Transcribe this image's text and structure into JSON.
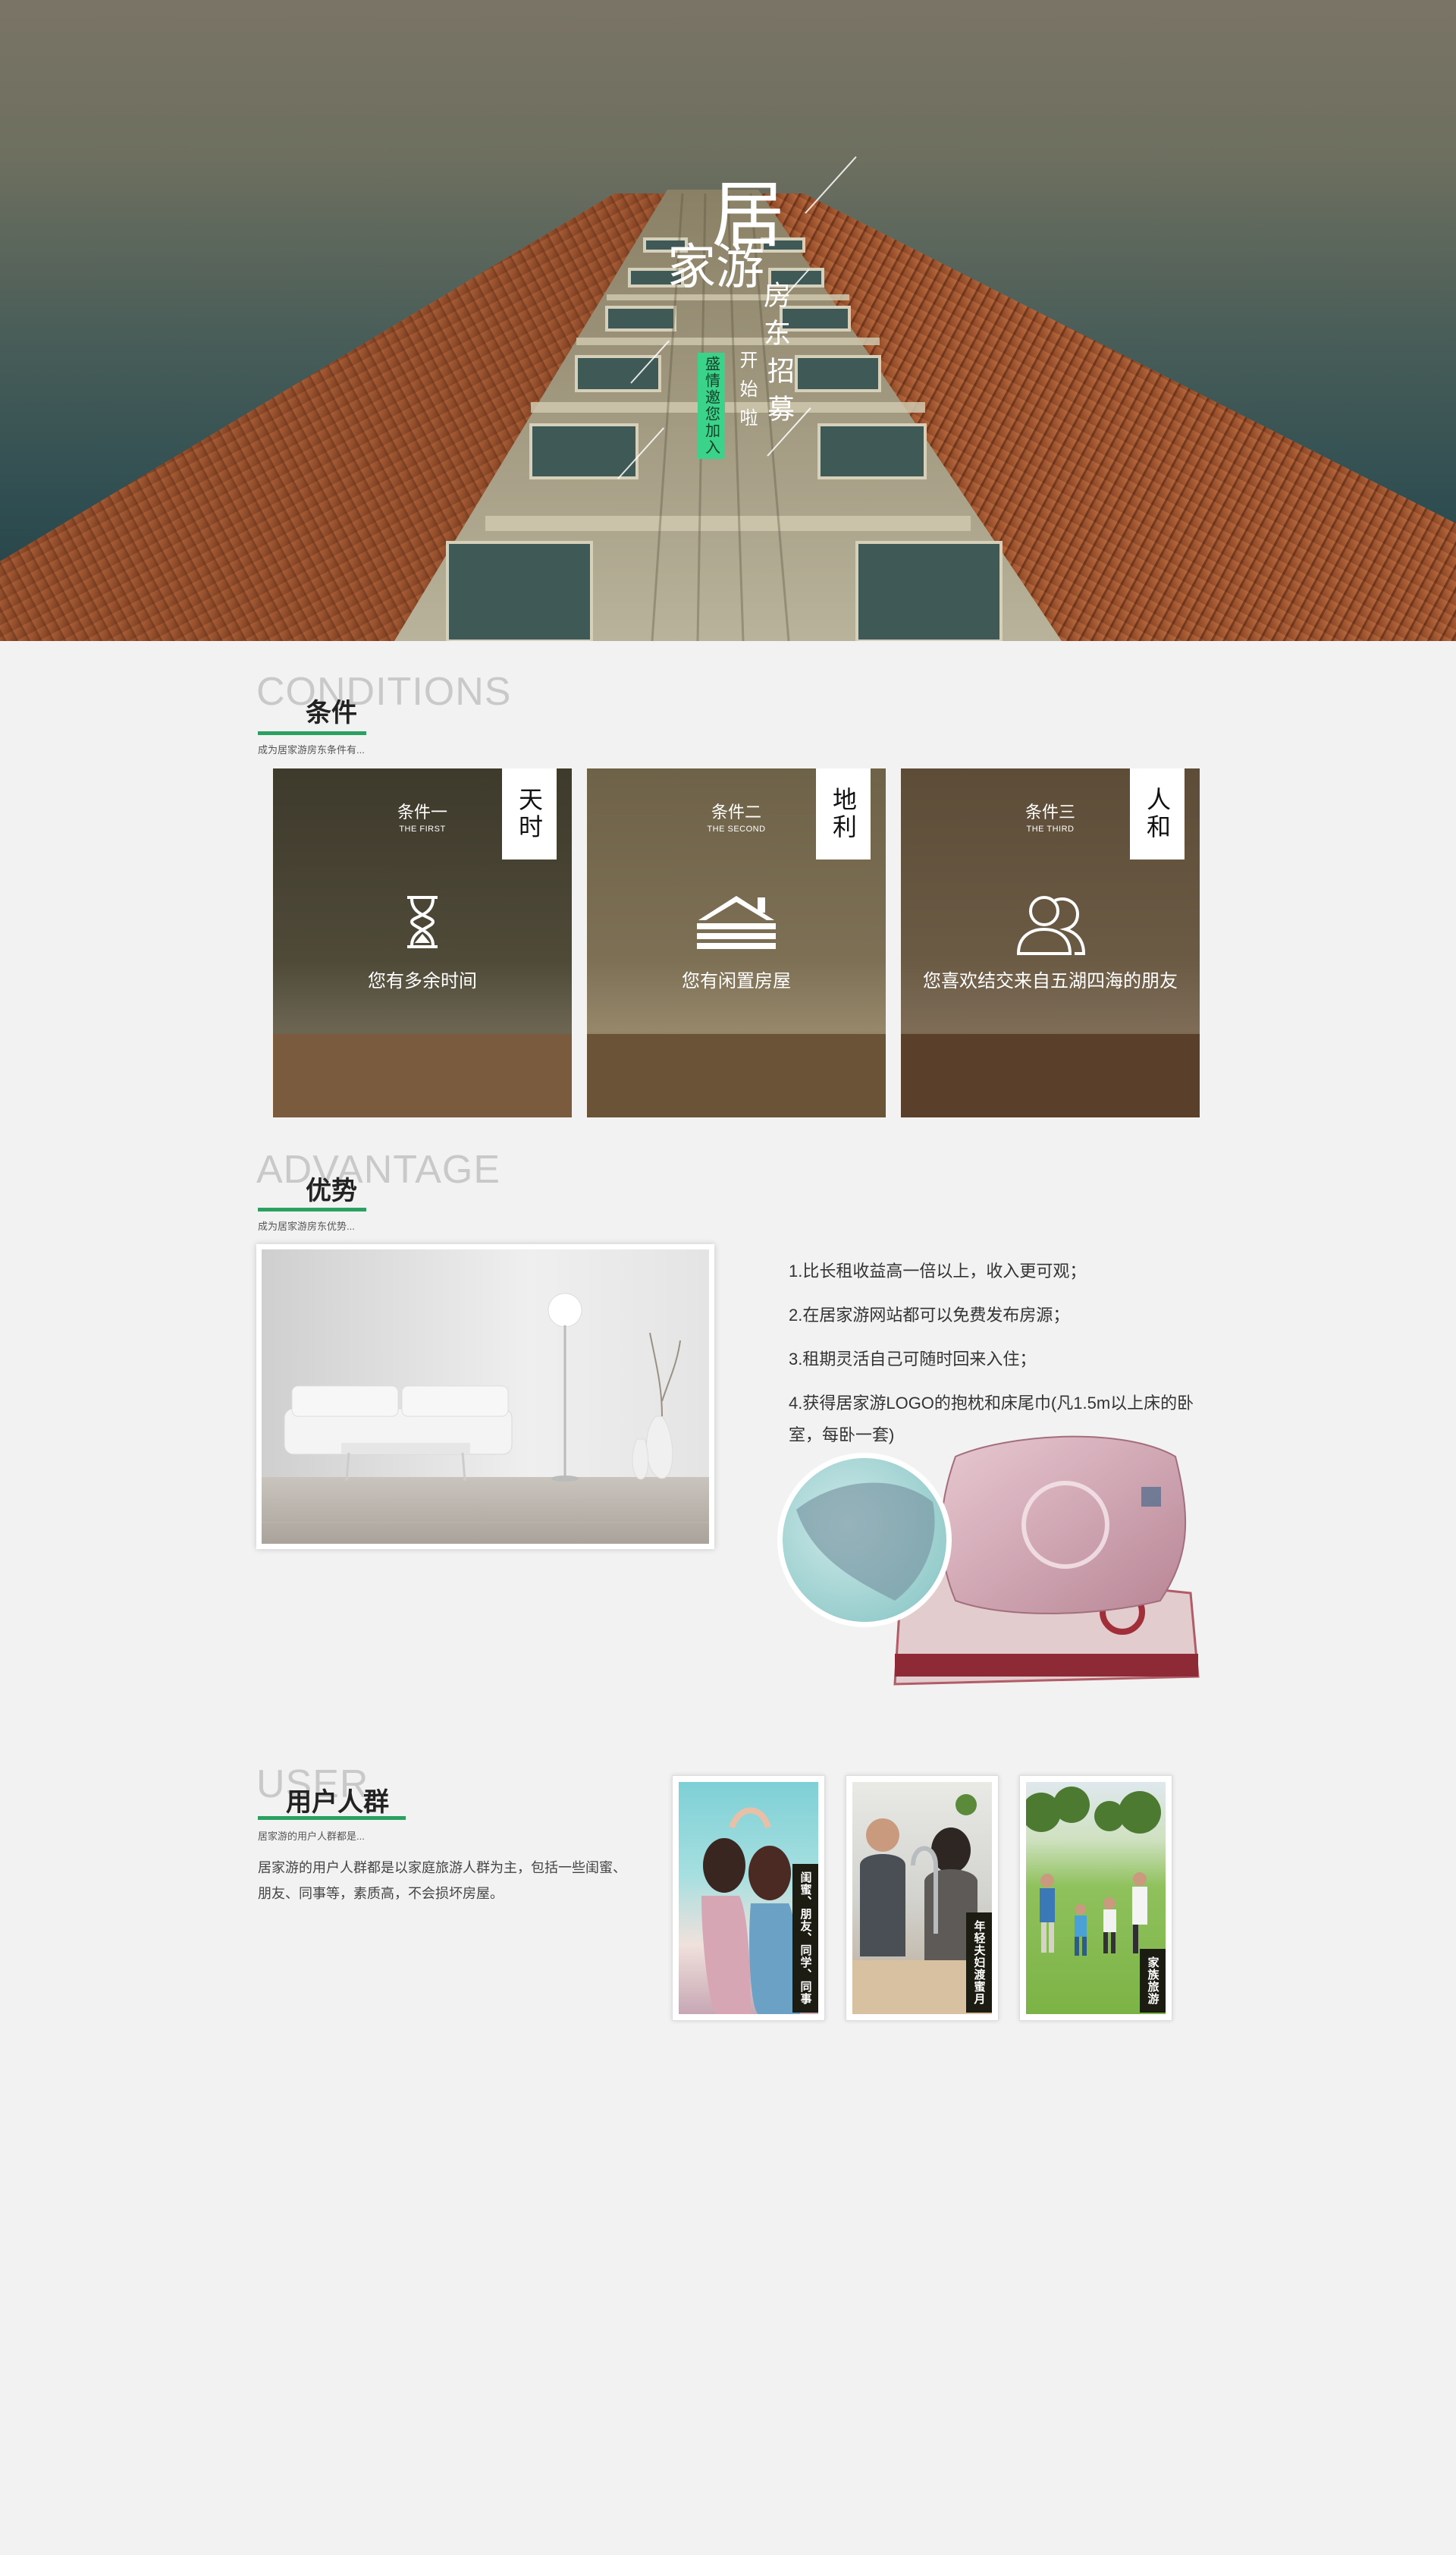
{
  "hero": {
    "title_ju": "居",
    "title_jiayou": "家游",
    "title_fangdong": "房东",
    "title_zhaomu": "招募",
    "tag_start": "开始啦",
    "tag_invite": "盛情邀您加入",
    "accent_color": "#3bd38a"
  },
  "conditions": {
    "en": "CONDITIONS",
    "cn": "条件",
    "sub": "成为居家游房东条件有...",
    "cards": [
      {
        "badge": "天时",
        "title": "条件一",
        "subtitle": "THE FIRST",
        "text": "您有多余时间",
        "icon": "hourglass-icon"
      },
      {
        "badge": "地利",
        "title": "条件二",
        "subtitle": "THE SECOND",
        "text": "您有闲置房屋",
        "icon": "house-icon"
      },
      {
        "badge": "人和",
        "title": "条件三",
        "subtitle": "THE THIRD",
        "text": "您喜欢结交来自五湖四海的朋友",
        "icon": "people-icon"
      }
    ]
  },
  "advantage": {
    "en": "ADVANTAGE",
    "cn": "优势",
    "sub": "成为居家游房东优势...",
    "items": [
      "1.比长租收益高一倍以上，收入更可观；",
      "2.在居家游网站都可以免费发布房源；",
      "3.租期灵活自己可随时回来入住；",
      "4.获得居家游LOGO的抱枕和床尾巾(凡1.5m以上床的卧室，每卧一套)"
    ]
  },
  "users": {
    "en": "USER",
    "cn": "用户人群",
    "sub": "居家游的用户人群都是...",
    "desc": "居家游的用户人群都是以家庭旅游人群为主，包括一些闺蜜、朋友、同事等，素质高，不会损坏房屋。",
    "photos": [
      {
        "label": "闺蜜、朋友、同学、同事"
      },
      {
        "label": "年轻夫妇渡蜜月"
      },
      {
        "label": "家族旅游"
      }
    ]
  },
  "colors": {
    "accent_green": "#2aa160",
    "background": "#f2f2f2"
  }
}
